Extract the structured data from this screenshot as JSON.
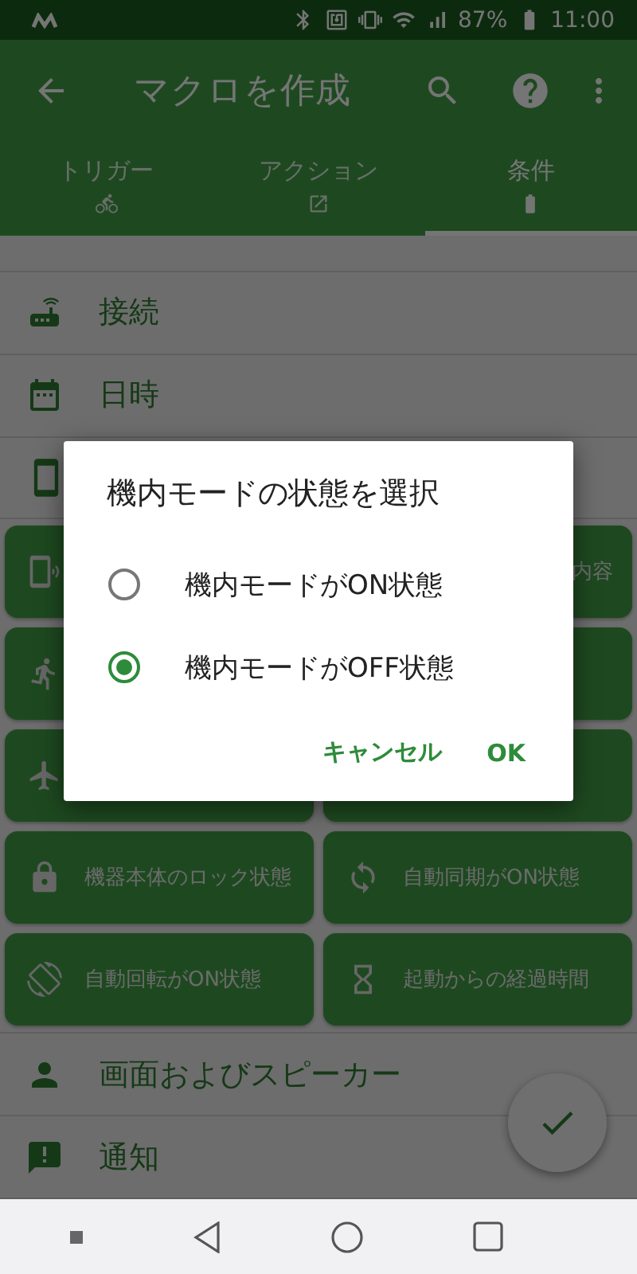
{
  "status_bar": {
    "battery": "87%",
    "time": "11:00"
  },
  "app_bar": {
    "title": "マクロを作成"
  },
  "tabs": [
    {
      "label": "トリガー",
      "selected": false
    },
    {
      "label": "アクション",
      "selected": false
    },
    {
      "label": "条件",
      "selected": true
    }
  ],
  "categories_top": [
    "接続",
    "日時"
  ],
  "partial_tile": {
    "label": "内容"
  },
  "tiles": [
    {
      "label": "機器本体のロック状態"
    },
    {
      "label": "自動同期がON状態"
    },
    {
      "label": "自動回転がON状態"
    },
    {
      "label": "起動からの経過時間"
    }
  ],
  "categories_bottom": [
    "画面およびスピーカー",
    "通知"
  ],
  "dialog": {
    "title": "機内モードの状態を選択",
    "options": [
      {
        "label": "機内モードがON状態",
        "selected": false
      },
      {
        "label": "機内モードがOFF状態",
        "selected": true
      }
    ],
    "buttons": [
      "キャンセル",
      "OK"
    ]
  }
}
